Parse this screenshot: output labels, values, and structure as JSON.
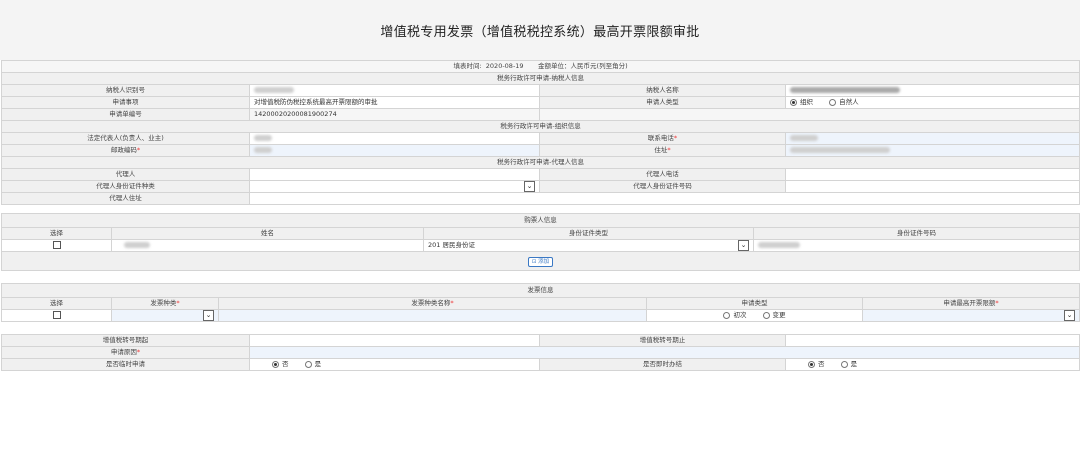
{
  "page": {
    "title": "增值税专用发票（增值税税控系统）最高开票限额审批"
  },
  "fill_info": {
    "time_label": "填表时间:",
    "time_value": "2020-08-19",
    "unit": "金额单位：人民币元(列至角分)"
  },
  "section_taxpayer": {
    "title": "税务行政许可申请-纳税人信息"
  },
  "taxpayer": {
    "id_label": "纳税人识别号",
    "name_label": "纳税人名称",
    "item_label": "申请事项",
    "item_value": "对增值税防伪税控系统最高开票限额的审批",
    "applicant_type_label": "申请人类型",
    "applicant_type_opt1": "组织",
    "applicant_type_opt2": "自然人",
    "form_no_label": "申请单编号",
    "form_no_value": "14200020200081900274"
  },
  "section_org": {
    "title": "税务行政许可申请-组织信息"
  },
  "org": {
    "legal_rep_label": "法定代表人(负责人、业主)",
    "phone_label": "联系电话",
    "postcode_label": "邮政编码",
    "address_label": "住址"
  },
  "section_agent": {
    "title": "税务行政许可申请-代理人信息"
  },
  "agent": {
    "agent_label": "代理人",
    "agent_phone_label": "代理人电话",
    "id_type_label": "代理人身份证件种类",
    "id_no_label": "代理人身份证件号码",
    "address_label": "代理人住址"
  },
  "buyer": {
    "section_title": "购票人信息",
    "col_select": "选择",
    "col_name": "姓名",
    "col_id_type": "身份证件类型",
    "col_id_no": "身份证件号码",
    "row_id_type": "201 居民身份证",
    "add_button": "添加"
  },
  "invoice": {
    "section_title": "发票信息",
    "col_select": "选择",
    "col_kind": "发票种类",
    "col_kind_name": "发票种类名称",
    "col_apply_type": "申请类型",
    "col_max_limit": "申请最高开票限额",
    "apply_opt1": "初次",
    "apply_opt2": "变更"
  },
  "bottom": {
    "num_start_label": "增值税转号期起",
    "num_end_label": "增值税转号期止",
    "reason_label": "申请原因",
    "temp_label": "是否临时申请",
    "instant_label": "是否即时办结",
    "opt_no": "否",
    "opt_yes": "是"
  },
  "colors": {
    "label_bg": "#f0f0f0",
    "input_blue": "#eef4fc",
    "required": "#e33333",
    "border": "#d4d4d4"
  }
}
